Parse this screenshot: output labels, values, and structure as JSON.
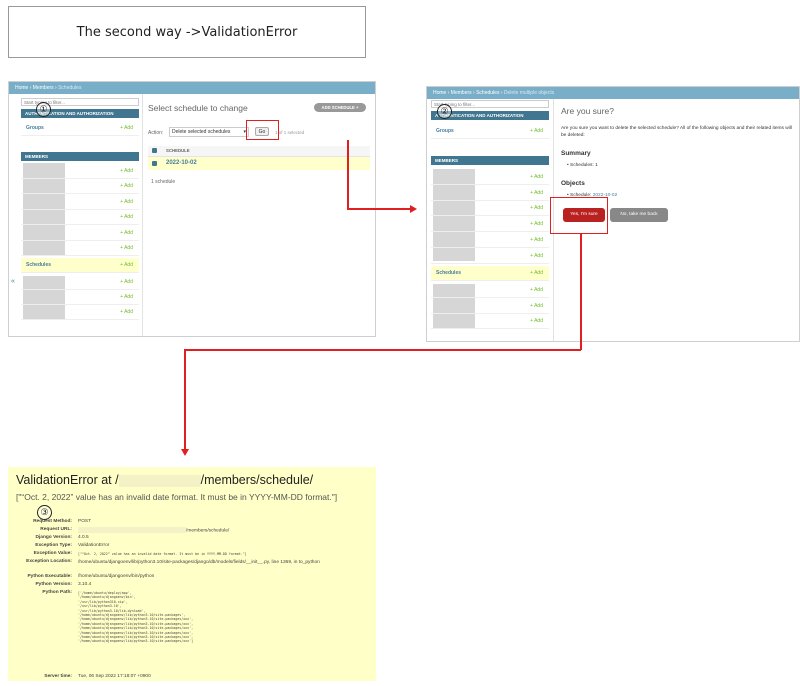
{
  "title": "The second way  ->ValidationError",
  "markers": {
    "one": "①",
    "two": "②",
    "three": "③"
  },
  "panel1": {
    "breadcrumb_home": "Home",
    "sep": "›",
    "breadcrumb_members": "Members",
    "breadcrumb_current": "Schedules",
    "filter_placeholder": "Start typing to filter...",
    "auth_header": "AUTHENTICATION AND AUTHORIZATION",
    "groups_label": "Groups",
    "add_label": "+ Add",
    "members_header": "MEMBERS",
    "schedules_label": "Schedules",
    "collapse_icon": "«",
    "page_title": "Select schedule to change",
    "add_schedule_btn": "ADD SCHEDULE +",
    "action_label": "Action:",
    "action_select": "Delete selected schedules",
    "go_btn": "Go",
    "selected_count": "1 of 1 selected",
    "column_header": "SCHEDULE",
    "row_value": "2022-10-02",
    "count": "1 schedule"
  },
  "panel2": {
    "breadcrumb_home": "Home",
    "breadcrumb_members": "Members",
    "breadcrumb_schedules": "Schedules",
    "breadcrumb_current": "Delete multiple objects",
    "filter_placeholder": "Start typing to filter...",
    "auth_header": "AUTHENTICATION AND AUTHORIZATION",
    "groups_label": "Groups",
    "add_label": "+ Add",
    "members_header": "MEMBERS",
    "schedules_label": "Schedules",
    "collapse_icon": "«",
    "heading": "Are you sure?",
    "message": "Are you sure you want to delete the selected schedule? All of the following objects and their related items will be deleted:",
    "summary_heading": "Summary",
    "summary_item": "Schedules: 1",
    "objects_heading": "Objects",
    "object_prefix": "Schedule:",
    "object_link": "2022-10-02",
    "confirm_btn": "Yes, I'm sure",
    "back_btn": "No, take me back"
  },
  "error": {
    "title_prefix": "ValidationError at /",
    "title_suffix": "/members/schedule/",
    "message": "[\"“Oct. 2, 2022” value has an invalid date format. It must be in YYYY-MM-DD format.\"]",
    "rows": [
      {
        "k": "Request Method:",
        "v": "POST"
      },
      {
        "k": "Request URL:",
        "v": "/members/schedule/"
      },
      {
        "k": "Django Version:",
        "v": "4.0.5"
      },
      {
        "k": "Exception Type:",
        "v": "ValidationError"
      },
      {
        "k": "Exception Value:",
        "v": "[\"“Oct. 2, 2022” value has an invalid date format. It must be in YYYY-MM-DD format.\"]"
      },
      {
        "k": "Exception Location:",
        "v": "/home/ubuntu/djangoenv/lib/python3.10/site-packages/django/db/models/fields/__init__.py, line 1369, in to_python"
      },
      {
        "k": "Python Executable:",
        "v": "/home/ubuntu/djangoenv/bin/python"
      },
      {
        "k": "Python Version:",
        "v": "3.10.4"
      }
    ],
    "path_label": "Python Path:",
    "path_lines": [
      "['/home/ubuntu/deploy/app',",
      " '/home/ubuntu/djangoenv/bin',",
      " '/usr/lib/python310.zip',",
      " '/usr/lib/python3.10',",
      " '/usr/lib/python3.10/lib-dynload',",
      " '/home/ubuntu/djangoenv/lib/python3.10/site-packages',",
      " '/home/ubuntu/djangoenv/lib/python3.10/site-packages/xxx',",
      " '/home/ubuntu/djangoenv/lib/python3.10/site-packages/xxx',",
      " '/home/ubuntu/djangoenv/lib/python3.10/site-packages/xxx',",
      " '/home/ubuntu/djangoenv/lib/python3.10/site-packages/xxx',",
      " '/home/ubuntu/djangoenv/lib/python3.10/site-packages/xxx',",
      " '/home/ubuntu/djangoenv/lib/python3.10/site-packages/xxx']"
    ],
    "server_time_label": "Server time:",
    "server_time": "Tue, 06 Sep 2022 17:18:07 +0900"
  }
}
